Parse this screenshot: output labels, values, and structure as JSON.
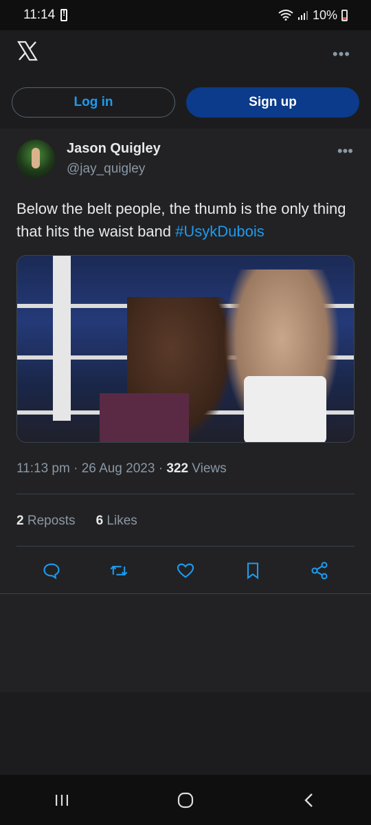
{
  "status_bar": {
    "time": "11:14",
    "battery": "10%"
  },
  "header": {
    "login_label": "Log in",
    "signup_label": "Sign up",
    "accent": "#1d9bf0",
    "signup_bg": "#0b3b8a"
  },
  "tweet": {
    "author_name": "Jason Quigley",
    "author_handle": "@jay_quigley",
    "text_plain": "Below the belt people, the thumb is the only thing that hits the waist band ",
    "hashtag": "#UsykDubois",
    "time": "11:13 pm",
    "date": "26 Aug 2023",
    "views_count": "322",
    "views_label": "Views",
    "reposts_count": "2",
    "reposts_label": "Reposts",
    "likes_count": "6",
    "likes_label": "Likes"
  },
  "icons": {
    "reply": "comment-icon",
    "repost": "repost-icon",
    "like": "heart-icon",
    "bookmark": "bookmark-icon",
    "share": "share-icon"
  }
}
